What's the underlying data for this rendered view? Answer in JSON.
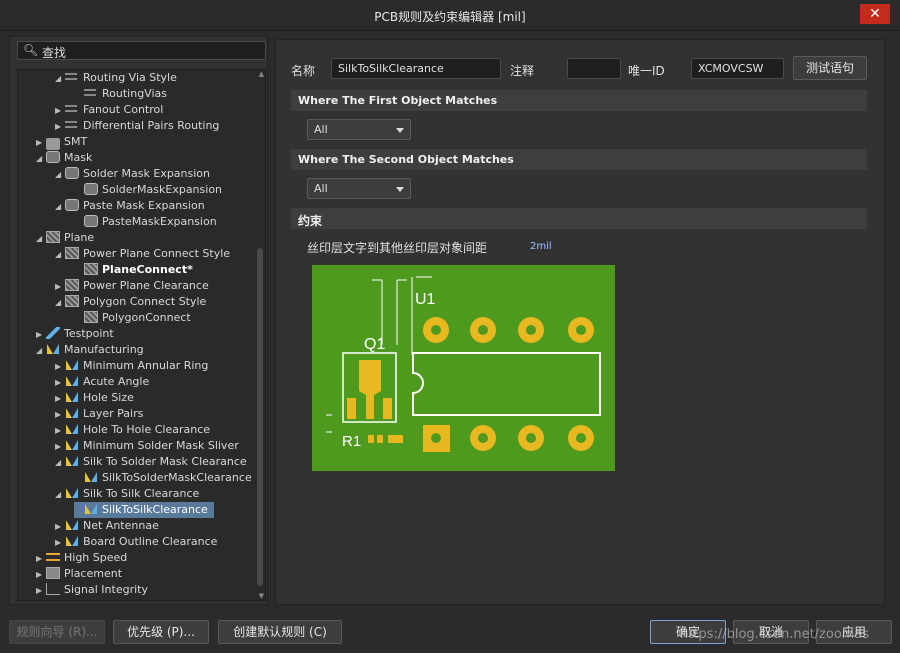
{
  "window": {
    "title": "PCB规则及约束编辑器 [mil]",
    "close_glyph": "✕"
  },
  "search": {
    "icon": "search-icon",
    "text": "查找"
  },
  "tree": {
    "items": [
      {
        "label": "Routing Via Style",
        "icon": "rule-icon",
        "expanded": true
      },
      {
        "label": "RoutingVias",
        "icon": "rule-icon"
      },
      {
        "label": "Fanout Control",
        "icon": "rule-icon",
        "expanded": false
      },
      {
        "label": "Differential Pairs Routing",
        "icon": "rule-icon",
        "expanded": false
      },
      {
        "label": "SMT",
        "icon": "smt-icon",
        "expanded": false
      },
      {
        "label": "Mask",
        "icon": "mask-icon",
        "expanded": true
      },
      {
        "label": "Solder Mask Expansion",
        "icon": "mask-icon",
        "expanded": true
      },
      {
        "label": "SolderMaskExpansion",
        "icon": "mask-icon"
      },
      {
        "label": "Paste Mask Expansion",
        "icon": "mask-icon",
        "expanded": true
      },
      {
        "label": "PasteMaskExpansion",
        "icon": "mask-icon"
      },
      {
        "label": "Plane",
        "icon": "plane-icon",
        "expanded": true
      },
      {
        "label": "Power Plane Connect Style",
        "icon": "plane-icon",
        "expanded": true
      },
      {
        "label": "PlaneConnect*",
        "icon": "plane-icon"
      },
      {
        "label": "Power Plane Clearance",
        "icon": "plane-icon",
        "expanded": false
      },
      {
        "label": "Polygon Connect Style",
        "icon": "plane-icon",
        "expanded": true
      },
      {
        "label": "PolygonConnect",
        "icon": "plane-icon"
      },
      {
        "label": "Testpoint",
        "icon": "testpoint-icon",
        "expanded": false
      },
      {
        "label": "Manufacturing",
        "icon": "manufacturing-icon",
        "expanded": true
      },
      {
        "label": "Minimum Annular Ring",
        "icon": "manufacturing-icon",
        "expanded": false
      },
      {
        "label": "Acute Angle",
        "icon": "manufacturing-icon",
        "expanded": false
      },
      {
        "label": "Hole Size",
        "icon": "manufacturing-icon",
        "expanded": false
      },
      {
        "label": "Layer Pairs",
        "icon": "manufacturing-icon",
        "expanded": false
      },
      {
        "label": "Hole To Hole Clearance",
        "icon": "manufacturing-icon",
        "expanded": false
      },
      {
        "label": "Minimum Solder Mask Sliver",
        "icon": "manufacturing-icon",
        "expanded": false
      },
      {
        "label": "Silk To Solder Mask Clearance",
        "icon": "manufacturing-icon",
        "expanded": true
      },
      {
        "label": "SilkToSolderMaskClearance",
        "icon": "manufacturing-icon"
      },
      {
        "label": "Silk To Silk Clearance",
        "icon": "manufacturing-icon",
        "expanded": true
      },
      {
        "label": "SilkToSilkClearance",
        "icon": "manufacturing-icon",
        "selected": true
      },
      {
        "label": "Net Antennae",
        "icon": "manufacturing-icon",
        "expanded": false
      },
      {
        "label": "Board Outline Clearance",
        "icon": "manufacturing-icon",
        "expanded": false
      },
      {
        "label": "High Speed",
        "icon": "high-speed-icon",
        "expanded": false
      },
      {
        "label": "Placement",
        "icon": "placement-icon",
        "expanded": false
      },
      {
        "label": "Signal Integrity",
        "icon": "signal-integrity-icon",
        "expanded": false
      }
    ]
  },
  "rule": {
    "name_label": "名称",
    "name_value": "SilkToSilkClearance",
    "comment_label": "注释",
    "comment_value": "",
    "uid_label": "唯一ID",
    "uid_value": "XCMOVCSW",
    "test_button": "测试语句"
  },
  "first_match": {
    "header": "Where The First Object Matches",
    "selected": "All"
  },
  "second_match": {
    "header": "Where The Second Object Matches",
    "selected": "All"
  },
  "constraints": {
    "header": "约束",
    "clearance_label": "丝印层文字到其他丝印层对象间距",
    "clearance_value": "2mil"
  },
  "pcb_illustration": {
    "label_u1": "U1",
    "label_q1": "Q1",
    "label_r1": "R1",
    "board_color": "#4e9a1f",
    "pad_color": "#e8b821",
    "silk_color": "#ffffff"
  },
  "footer": {
    "wizard_button": "规则向导 (R)...",
    "priority_button": "优先级 (P)...",
    "default_rules_button": "创建默认规则 (C)",
    "ok_button": "确定",
    "cancel_button": "取消",
    "apply_button": "应用"
  },
  "watermark": "https://blog.csdn.net/zoomas"
}
